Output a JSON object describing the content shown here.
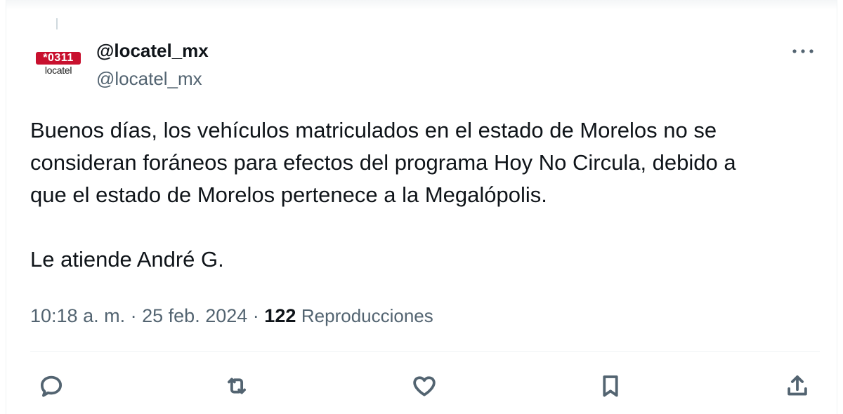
{
  "author": {
    "display_name": "@locatel_mx",
    "handle": "@locatel_mx",
    "avatar": {
      "badge_text": "*0311",
      "word_text": "locatel",
      "badge_color": "#c8102e"
    }
  },
  "tweet": {
    "text": "Buenos días, los vehículos matriculados en el estado de Morelos no se\nconsideran foráneos para efectos del programa Hoy No Circula, debido a\nque el estado de Morelos pertenece a la Megalópolis.\n\nLe atiende André G.",
    "time": "10:18 a. m.",
    "separator": "·",
    "date": "25 feb. 2024",
    "views_count": "122",
    "views_label": "Reproducciones"
  },
  "actions": [
    {
      "name": "reply",
      "icon": "reply-icon"
    },
    {
      "name": "retweet",
      "icon": "retweet-icon"
    },
    {
      "name": "like",
      "icon": "heart-icon"
    },
    {
      "name": "bookmark",
      "icon": "bookmark-icon"
    },
    {
      "name": "share",
      "icon": "share-icon"
    }
  ],
  "colors": {
    "text_primary": "#0f1419",
    "text_secondary": "#536471",
    "divider": "#eff3f4"
  }
}
